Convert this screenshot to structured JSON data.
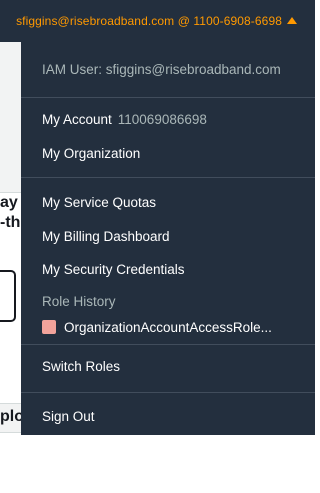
{
  "account_menu": {
    "trigger_label": "sfiggins@risebroadband.com @ 1100-6908-6698",
    "iam_user": "IAM User: sfiggins@risebroadband.com",
    "my_account_label": "My Account",
    "account_number": "110069086698",
    "my_organization_label": "My Organization",
    "service_quotas_label": "My Service Quotas",
    "billing_dashboard_label": "My Billing Dashboard",
    "security_credentials_label": "My Security Credentials",
    "role_history_label": "Role History",
    "role_history": [
      {
        "label": "OrganizationAccountAccessRole...",
        "color": "#f2a39b"
      }
    ],
    "switch_roles_label": "Switch Roles",
    "sign_out_label": "Sign Out"
  },
  "background_page": {
    "heading_fragment_1": "ay",
    "heading_fragment_2": "-th",
    "heading_fragment_3": "plo"
  },
  "colors": {
    "nav_background": "#232f3e",
    "accent": "#ff9900",
    "muted_text": "#aab7b8"
  }
}
